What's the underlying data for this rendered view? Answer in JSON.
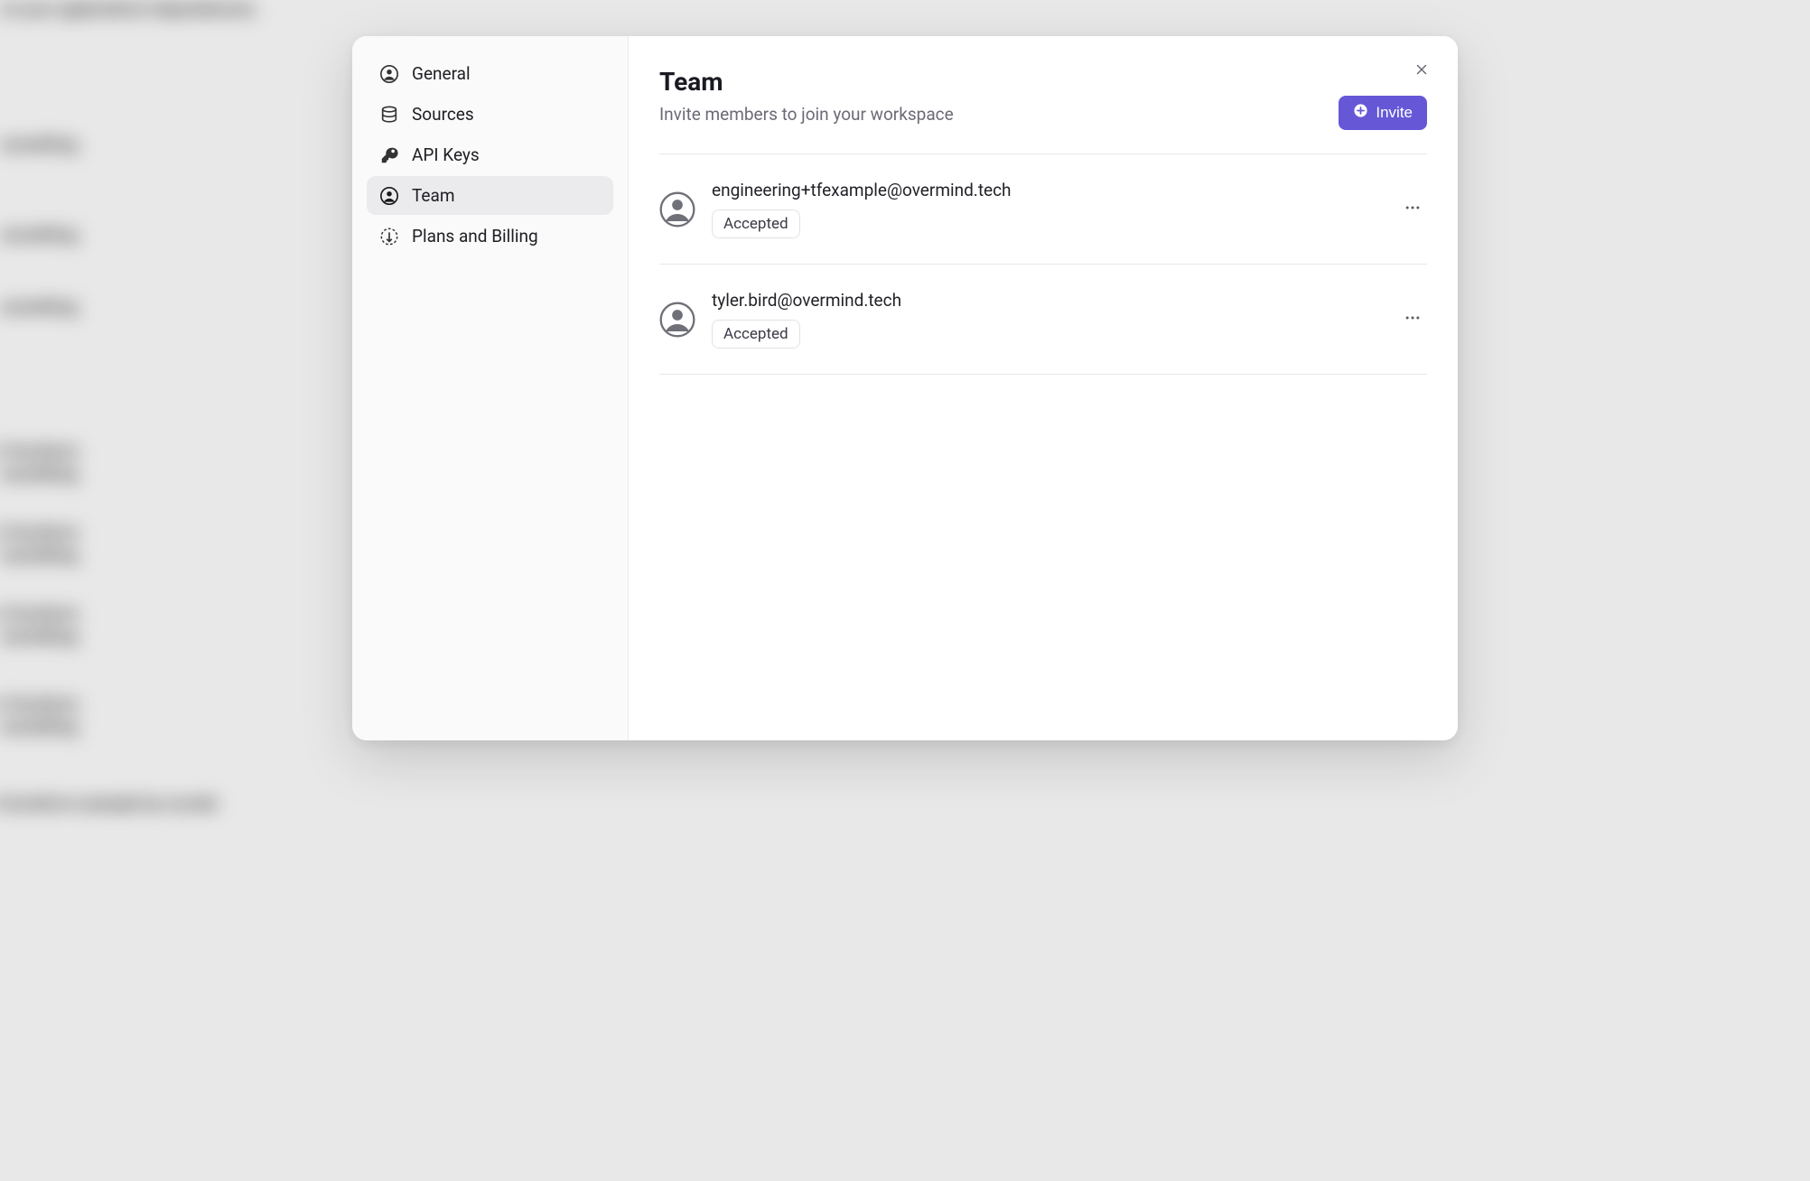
{
  "sidebar": {
    "items": [
      {
        "label": "General"
      },
      {
        "label": "Sources"
      },
      {
        "label": "API Keys"
      },
      {
        "label": "Team"
      },
      {
        "label": "Plans and Billing"
      }
    ]
  },
  "header": {
    "title": "Team",
    "subtitle": "Invite members to join your workspace",
    "invite_label": "Invite"
  },
  "members": [
    {
      "email": "engineering+tfexample@overmind.tech",
      "status": "Accepted"
    },
    {
      "email": "tyler.bird@overmind.tech",
      "status": "Accepted"
    }
  ],
  "colors": {
    "accent": "#6557d6"
  }
}
